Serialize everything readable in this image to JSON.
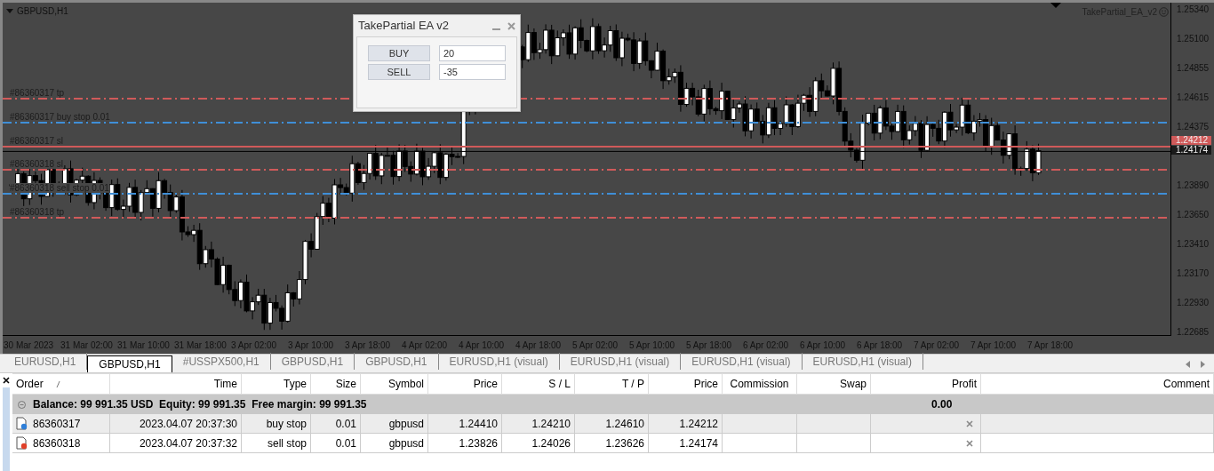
{
  "chart": {
    "symbol": "GBPUSD,H1",
    "expert": "TakePartial_EA_v2",
    "order_lines": [
      {
        "label": "#86360317 tp",
        "color": "#d05a5a"
      },
      {
        "label": "#86360317 buy stop 0.01",
        "color": "#3f8fd8"
      },
      {
        "label": "#86360317 sl",
        "color": "#d05a5a"
      },
      {
        "label": "#86360318 sl",
        "color": "#d05a5a"
      },
      {
        "label": "#86360318 sell stop 0.01",
        "color": "#3f8fd8"
      },
      {
        "label": "#86360318 tp",
        "color": "#d05a5a"
      }
    ],
    "price_labels": [
      "1.25340",
      "1.25100",
      "1.24855",
      "1.24615",
      "1.24375",
      "1.23890",
      "1.23650",
      "1.23410",
      "1.23170",
      "1.22930",
      "1.22685"
    ],
    "price_tags": [
      {
        "text": "1.24212",
        "color": "#d05a5a"
      },
      {
        "text": "1.24174",
        "color": "#1a1a1a"
      }
    ],
    "time_labels": [
      "30 Mar 2023",
      "31 Mar 02:00",
      "31 Mar 10:00",
      "31 Mar 18:00",
      "3 Apr 02:00",
      "3 Apr 10:00",
      "3 Apr 18:00",
      "4 Apr 02:00",
      "4 Apr 10:00",
      "4 Apr 18:00",
      "5 Apr 02:00",
      "5 Apr 10:00",
      "5 Apr 18:00",
      "6 Apr 02:00",
      "6 Apr 10:00",
      "6 Apr 18:00",
      "7 Apr 02:00",
      "7 Apr 10:00",
      "7 Apr 18:00"
    ]
  },
  "panel": {
    "title": "TakePartial EA v2",
    "rows": [
      {
        "button": "BUY",
        "value": "20"
      },
      {
        "button": "SELL",
        "value": "-35"
      }
    ]
  },
  "tabs": [
    {
      "label": "EURUSD,H1",
      "selected": false
    },
    {
      "label": "GBPUSD,H1",
      "selected": true
    },
    {
      "label": "#USSPX500,H1",
      "selected": false
    },
    {
      "label": "GBPUSD,H1",
      "selected": false
    },
    {
      "label": "GBPUSD,H1",
      "selected": false
    },
    {
      "label": "EURUSD,H1 (visual)",
      "selected": false
    },
    {
      "label": "EURUSD,H1 (visual)",
      "selected": false
    },
    {
      "label": "EURUSD,H1 (visual)",
      "selected": false
    },
    {
      "label": "EURUSD,H1 (visual)",
      "selected": false
    }
  ],
  "table": {
    "columns": [
      "Order",
      "Time",
      "Type",
      "Size",
      "Symbol",
      "Price",
      "S / L",
      "T / P",
      "Price",
      "Commission",
      "Swap",
      "Profit",
      "Comment"
    ],
    "summary": {
      "text": "Balance: 99 991.35 USD  Equity: 99 991.35  Free margin: 99 991.35",
      "profit": "0.00"
    },
    "rows": [
      {
        "kind": "buy",
        "selected": true,
        "cells": [
          "86360317",
          "2023.04.07 20:37:30",
          "buy stop",
          "0.01",
          "gbpusd",
          "1.24410",
          "1.24210",
          "1.24610",
          "1.24212"
        ]
      },
      {
        "kind": "sell",
        "selected": false,
        "cells": [
          "86360318",
          "2023.04.07 20:37:32",
          "sell stop",
          "0.01",
          "gbpusd",
          "1.23826",
          "1.24026",
          "1.23626",
          "1.24174"
        ]
      }
    ]
  }
}
